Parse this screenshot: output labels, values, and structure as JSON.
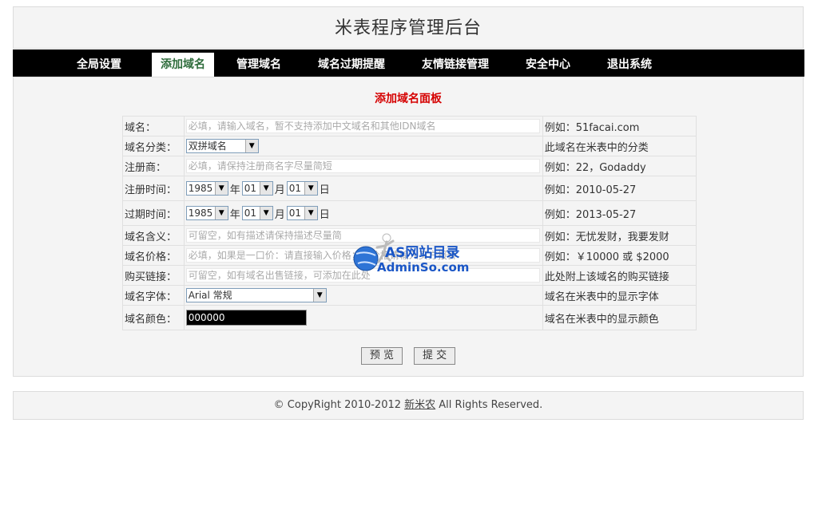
{
  "header": {
    "title": "米表程序管理后台"
  },
  "nav": {
    "items": [
      {
        "label": "全局设置",
        "active": false
      },
      {
        "label": "添加域名",
        "active": true
      },
      {
        "label": "管理域名",
        "active": false
      },
      {
        "label": "域名过期提醒",
        "active": false
      },
      {
        "label": "友情链接管理",
        "active": false
      },
      {
        "label": "安全中心",
        "active": false
      },
      {
        "label": "退出系统",
        "active": false
      }
    ]
  },
  "panel": {
    "title": "添加域名面板",
    "rows": {
      "domain": {
        "label": "域名：",
        "placeholder": "必填，请输入域名，暂不支持添加中文域名和其他IDN域名",
        "hint": "例如：51facai.com"
      },
      "category": {
        "label": "域名分类：",
        "value": "双拼域名",
        "hint": "此域名在米表中的分类"
      },
      "registrar": {
        "label": "注册商：",
        "placeholder": "必填，请保持注册商名字尽量简短",
        "hint": "例如：22，Godaddy"
      },
      "reg_date": {
        "label": "注册时间：",
        "year": "1985",
        "month": "01",
        "day": "01",
        "hint": "例如：2010-05-27"
      },
      "exp_date": {
        "label": "过期时间：",
        "year": "1985",
        "month": "01",
        "day": "01",
        "hint": "例如：2013-05-27"
      },
      "meaning": {
        "label": "域名含义：",
        "placeholder": "可留空，如有描述请保持描述尽量简",
        "hint": "例如：无忧发财，我要发财"
      },
      "price": {
        "label": "域名价格：",
        "placeholder": "必填，如果是一口价：请直接输入价格；无价格请输入买方报价",
        "hint": "例如：￥10000 或 $2000"
      },
      "buy_link": {
        "label": "购买链接：",
        "placeholder": "可留空，如有域名出售链接，可添加在此处",
        "hint": "此处附上该域名的购买链接"
      },
      "font": {
        "label": "域名字体：",
        "value": "Arial 常规",
        "hint": "域名在米表中的显示字体"
      },
      "color": {
        "label": "域名颜色：",
        "value": "000000",
        "hint": "域名在米表中的显示颜色"
      }
    },
    "date_units": {
      "year": "年",
      "month": "月",
      "day": "日"
    }
  },
  "buttons": {
    "preview": "预 览",
    "submit": "提 交"
  },
  "footer": {
    "prefix": "© CopyRight 2010-2012 ",
    "link": "新米农",
    "suffix": " All Rights Reserved."
  },
  "watermark": {
    "line1": "AS网站目录",
    "line2": "AdminSo.com"
  }
}
